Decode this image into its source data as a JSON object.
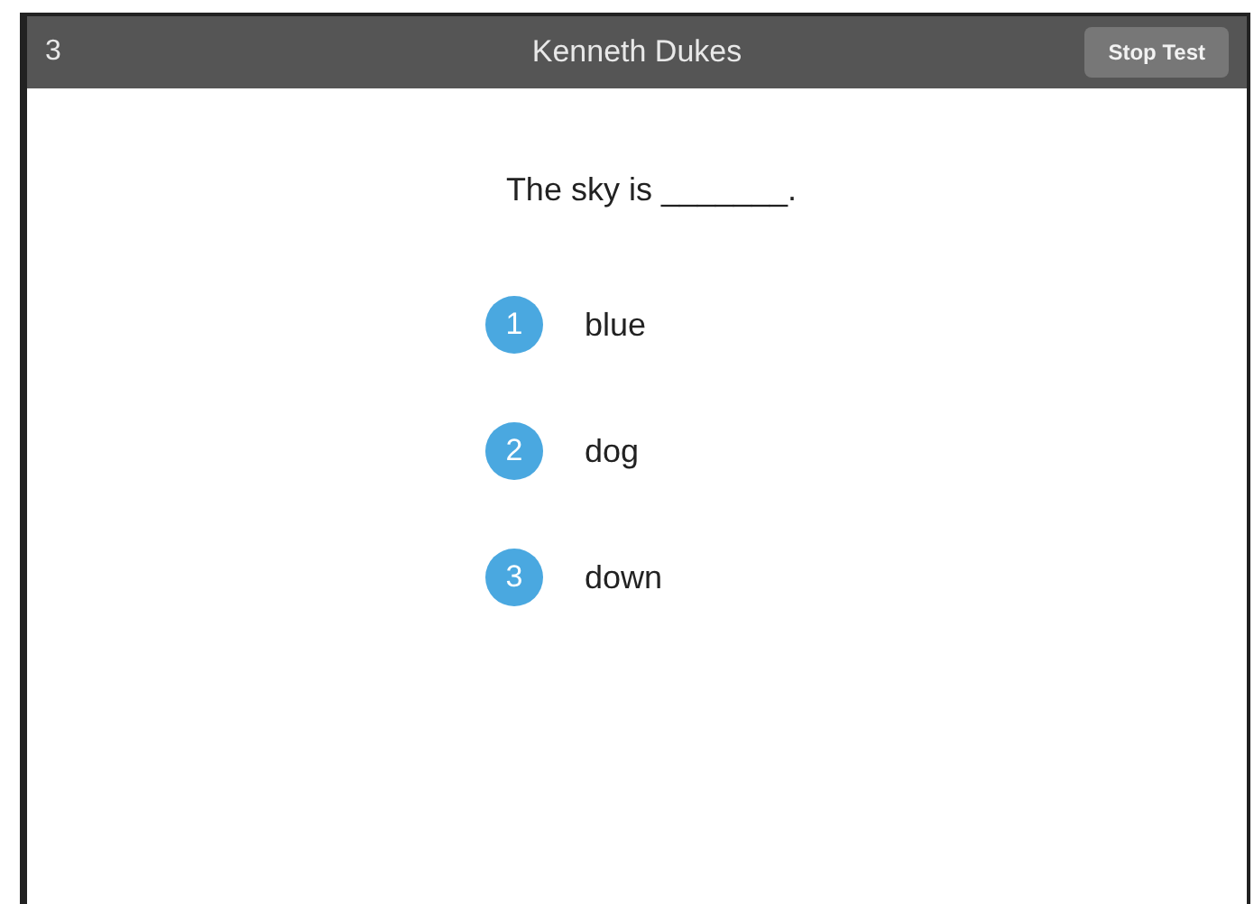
{
  "header": {
    "question_number": "3",
    "student_name": "Kenneth Dukes",
    "stop_button": "Stop Test"
  },
  "question": "The sky is _______.",
  "options": [
    {
      "number": "1",
      "text": "blue"
    },
    {
      "number": "2",
      "text": "dog"
    },
    {
      "number": "3",
      "text": "down"
    }
  ]
}
